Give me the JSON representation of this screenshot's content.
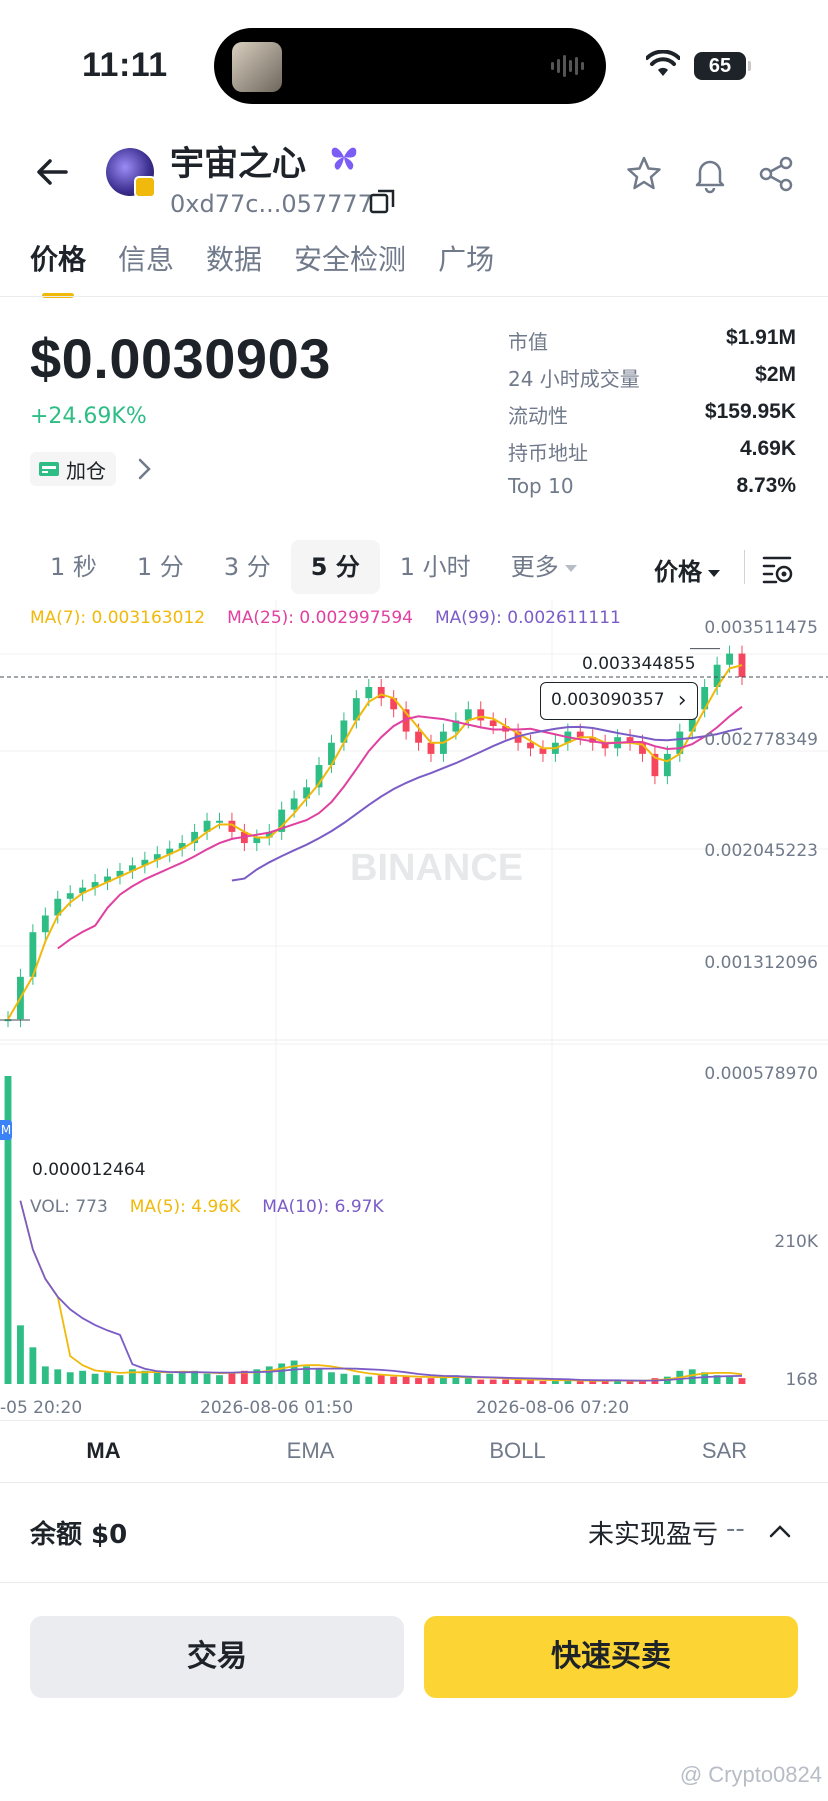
{
  "status_bar": {
    "time": "11:11",
    "battery": "65"
  },
  "header": {
    "token_name": "宇宙之心",
    "address": "0xd77c...057777"
  },
  "tabs": [
    {
      "label": "价格"
    },
    {
      "label": "信息"
    },
    {
      "label": "数据"
    },
    {
      "label": "安全检测"
    },
    {
      "label": "广场"
    }
  ],
  "price": {
    "value": "$0.0030903",
    "change": "+24.69K%",
    "add_position": "加仓"
  },
  "stats": [
    {
      "label": "市值",
      "value": "$1.91M"
    },
    {
      "label": "24 小时成交量",
      "value": "$2M"
    },
    {
      "label": "流动性",
      "value": "$159.95K"
    },
    {
      "label": "持币地址",
      "value": "4.69K"
    },
    {
      "label": "Top 10",
      "value": "8.73%"
    }
  ],
  "intervals": [
    {
      "label": "1 秒"
    },
    {
      "label": "1 分"
    },
    {
      "label": "3 分"
    },
    {
      "label": "5 分"
    },
    {
      "label": "1 小时"
    },
    {
      "label": "更多"
    }
  ],
  "chart_mode": "价格",
  "chart_data": {
    "type": "line",
    "ma_legend": {
      "ma7": "MA(7): 0.003163012",
      "ma25": "MA(25): 0.002997594",
      "ma99": "MA(99): 0.002611111"
    },
    "vol_legend": {
      "vol": "VOL: 773",
      "ma5": "MA(5): 4.96K",
      "ma10": "MA(10): 6.97K"
    },
    "y_ticks": [
      "0.003511475",
      "0.002778349",
      "0.002045223",
      "0.001312096",
      "0.000578970"
    ],
    "ylim": [
      1.2464e-05,
      0.003511475
    ],
    "vol_ticks": [
      "210K",
      "168"
    ],
    "x_ticks": [
      "-05 20:20",
      "2026-08-06 01:50",
      "2026-08-06 07:20"
    ],
    "high_label": "0.003344855",
    "low_label": "0.000012464",
    "current_label": "0.003090357",
    "watermark": "BINANCE",
    "marker": "M",
    "colors": {
      "up": "#2ebd85",
      "down": "#f6465d",
      "ma7": "#f0b90b",
      "ma25": "#e040a0",
      "ma99": "#7b5cc7"
    },
    "close_series": [
      2e-05,
      0.0004,
      0.0008,
      0.00095,
      0.0011,
      0.00115,
      0.0012,
      0.00125,
      0.0013,
      0.00135,
      0.0014,
      0.00145,
      0.0015,
      0.00155,
      0.0016,
      0.0017,
      0.0018,
      0.0018,
      0.0017,
      0.0016,
      0.00165,
      0.0017,
      0.0019,
      0.002,
      0.0021,
      0.0023,
      0.0025,
      0.0027,
      0.0029,
      0.003,
      0.0029,
      0.0028,
      0.0026,
      0.0025,
      0.0024,
      0.0026,
      0.0027,
      0.0028,
      0.0027,
      0.00265,
      0.0026,
      0.0025,
      0.00245,
      0.0024,
      0.0025,
      0.0026,
      0.00255,
      0.0025,
      0.00245,
      0.00255,
      0.0025,
      0.0024,
      0.0022,
      0.0024,
      0.0026,
      0.0028,
      0.003,
      0.0032,
      0.0033,
      0.00309
    ],
    "volume_series": [
      210,
      40,
      25,
      12,
      10,
      8,
      9,
      7,
      8,
      6,
      10,
      9,
      8,
      7,
      8,
      9,
      7,
      6,
      8,
      9,
      10,
      12,
      14,
      16,
      12,
      10,
      8,
      7,
      6,
      5,
      6,
      5,
      5,
      4,
      4,
      5,
      6,
      4,
      3,
      3,
      3,
      3,
      3,
      2,
      2,
      3,
      2,
      2,
      2,
      3,
      2,
      2,
      4,
      5,
      9,
      10,
      8,
      6,
      5,
      4
    ]
  },
  "indicators": [
    {
      "label": "MA"
    },
    {
      "label": "EMA"
    },
    {
      "label": "BOLL"
    },
    {
      "label": "SAR"
    }
  ],
  "footer": {
    "balance": "余额 $0",
    "unrealized_pnl": "未实现盈亏",
    "pnl_value": "--",
    "trade_button": "交易",
    "quick_button": "快速买卖",
    "watermark": "@ Crypto0824"
  }
}
